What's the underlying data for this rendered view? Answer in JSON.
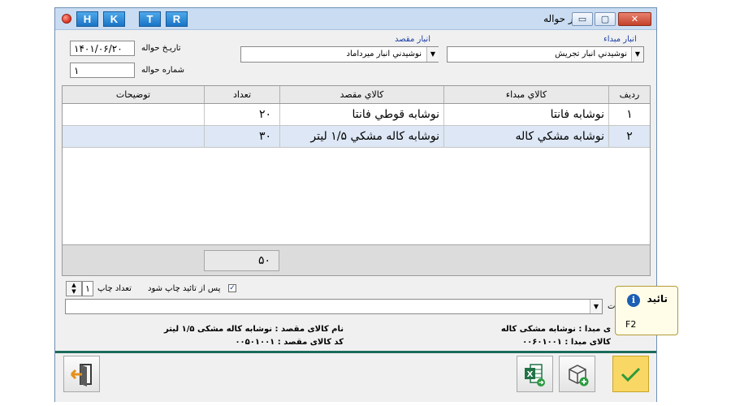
{
  "titlebar": {
    "letters": [
      "H",
      "K",
      "T",
      "R"
    ],
    "title": "صدور حواله",
    "controls": {
      "minimize": "▭",
      "restore": "▢",
      "close": "✕"
    }
  },
  "form": {
    "source_warehouse_label": "انبار مبداء",
    "source_warehouse_value": "نوشيدني انبار تجريش",
    "dest_warehouse_label": "انبار مقصد",
    "dest_warehouse_value": "نوشيدني انبار ميرداماد",
    "date_label": "تاريـخ حواله",
    "date_value": "۱۴۰۱/۰۶/۲۰",
    "number_label": "شماره حواله",
    "number_value": "۱"
  },
  "grid": {
    "headers": {
      "row": "رديف",
      "source_item": "کالاي مبداء",
      "dest_item": "کالاي مقصد",
      "qty": "تعداد",
      "notes": "توضيحات"
    },
    "rows": [
      {
        "row": "۱",
        "source_item": "نوشابه فانتا",
        "dest_item": "نوشابه قوطي فانتا",
        "qty": "۲۰",
        "notes": ""
      },
      {
        "row": "۲",
        "source_item": "نوشابه مشکي کاله",
        "dest_item": "نوشابه کاله مشکي ۱/۵ ليتر",
        "qty": "۳۰",
        "notes": ""
      }
    ],
    "total_qty": "۵۰"
  },
  "print": {
    "print_after_confirm_label": "پس از تائيد چاپ شود",
    "print_after_confirm_checked": true,
    "print_count_label": "تعداد چاپ",
    "print_count_value": "۱",
    "description_label_partial": "ت"
  },
  "info": {
    "source_item_name": "ی مبدا :  نوشابه مشکی کاله",
    "source_item_code": "کالای مبدا :  ۰۰۶۰۱۰۰۱",
    "dest_item_name": "نام کالای مقصد :  نوشابه کاله مشکی ۱/۵ ليتر",
    "dest_item_code": "کد کالای مقصد :  ۰۰۵۰۱۰۰۱"
  },
  "tooltip": {
    "title": "تائید",
    "shortcut": "F2"
  },
  "colors": {
    "titlebar": "#c9dcf1",
    "selected_row": "#dde7f5",
    "confirm_button": "#f8d765",
    "status_line": "#1c6b5a"
  },
  "icons": {
    "exit": "exit-door-icon",
    "excel": "excel-export-icon",
    "print": "print-package-icon",
    "confirm": "checkmark-icon",
    "info": "info-icon"
  }
}
